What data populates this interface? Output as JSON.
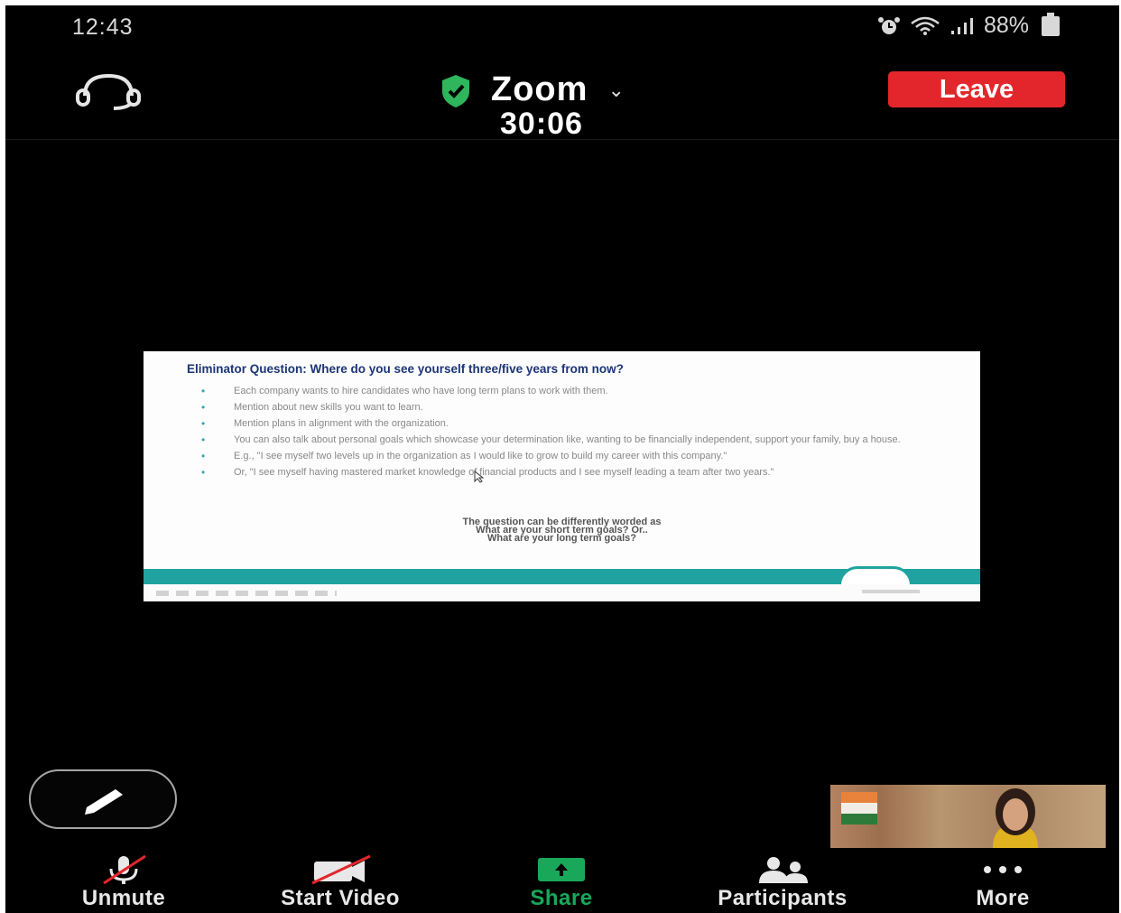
{
  "status_bar": {
    "time": "12:43",
    "battery": "88%",
    "icons": [
      "alarm-icon",
      "wifi-icon",
      "signal-icon",
      "battery-icon"
    ]
  },
  "header": {
    "audio_icon": "headphones-icon",
    "title": "Zoom",
    "timer": "30:06",
    "leave_label": "Leave",
    "shield_color": "#2fb55c",
    "leave_color": "#e3262b"
  },
  "slide": {
    "title": "Eliminator Question: Where do you see yourself three/five years from now?",
    "bullets": [
      "Each company wants to hire candidates who have long term plans to work with them.",
      "Mention about new skills you want to learn.",
      "Mention plans in alignment with the organization.",
      "You can also talk about personal goals which showcase your determination like, wanting to be financially independent, support your family, buy a house.",
      "E.g., \"I see myself two levels up in the organization as I would like to grow to build my career with this company.\"",
      "Or, \"I see myself having mastered market knowledge of financial products and I see myself leading a team after two years.\""
    ],
    "question_lines": [
      "The question can be differently worded as",
      "What are your short term goals? Or..",
      "What are your long term goals?"
    ],
    "accent_color": "#20a3a0"
  },
  "toolbar": {
    "unmute_label": "Unmute",
    "start_video_label": "Start Video",
    "share_label": "Share",
    "participants_label": "Participants",
    "more_label": "More",
    "share_color": "#19a85a"
  }
}
